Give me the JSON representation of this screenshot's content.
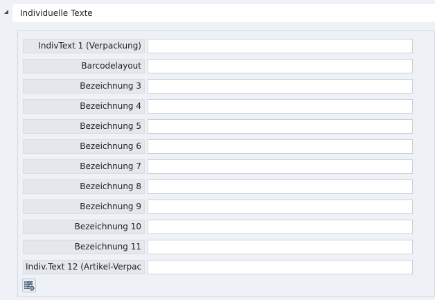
{
  "section": {
    "title": "Individuelle Texte",
    "collapse_icon": "collapse-arrow-icon"
  },
  "fields": [
    {
      "label": "IndivText 1 (Verpackung)",
      "value": ""
    },
    {
      "label": "Barcodelayout",
      "value": ""
    },
    {
      "label": "Bezeichnung 3",
      "value": ""
    },
    {
      "label": "Bezeichnung 4",
      "value": ""
    },
    {
      "label": "Bezeichnung 5",
      "value": ""
    },
    {
      "label": "Bezeichnung 6",
      "value": ""
    },
    {
      "label": "Bezeichnung 7",
      "value": ""
    },
    {
      "label": "Bezeichnung 8",
      "value": ""
    },
    {
      "label": "Bezeichnung 9",
      "value": ""
    },
    {
      "label": "Bezeichnung 10",
      "value": ""
    },
    {
      "label": "Bezeichnung 11",
      "value": ""
    },
    {
      "label": "Indiv.Text 12 (Artikel-Verpac",
      "value": ""
    }
  ],
  "toolbar": {
    "settings_icon": "list-settings-icon"
  }
}
